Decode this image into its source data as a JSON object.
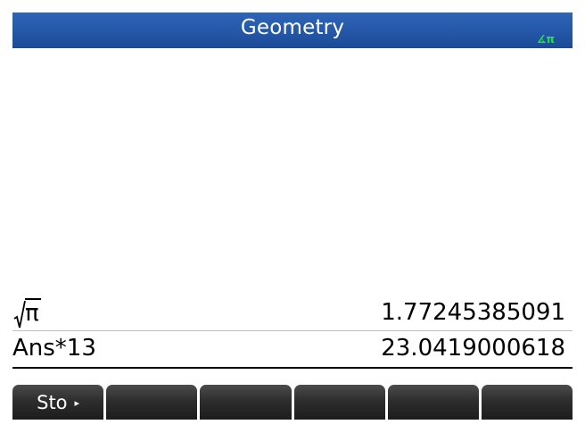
{
  "titlebar": {
    "title": "Geometry",
    "angle_indicator": "∡π"
  },
  "history": [
    {
      "expression": "π",
      "expression_has_sqrt": true,
      "result": "1.77245385091"
    },
    {
      "expression": "Ans*13",
      "result": "23.0419000618"
    }
  ],
  "menu": {
    "softkeys": [
      {
        "label": "Sto",
        "has_arrow": true,
        "arrow": "▸"
      },
      {
        "label": ""
      },
      {
        "label": ""
      },
      {
        "label": ""
      },
      {
        "label": ""
      },
      {
        "label": ""
      }
    ]
  },
  "colors": {
    "titlebar": "#2457a8",
    "angle_indicator": "#27e04a",
    "softkey": "#2e2e2e"
  }
}
